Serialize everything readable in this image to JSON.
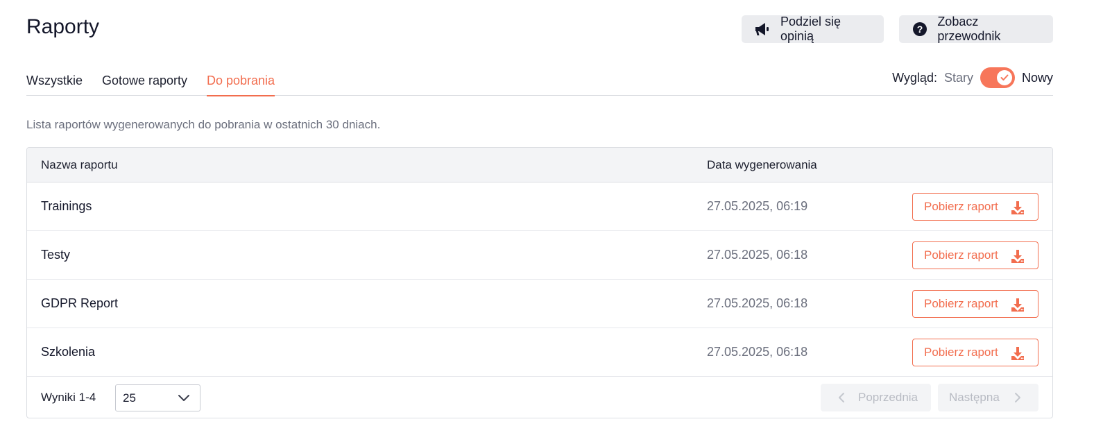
{
  "page": {
    "title": "Raporty"
  },
  "header_actions": {
    "feedback_label": "Podziel się opinią",
    "guide_label": "Zobacz przewodnik"
  },
  "tabs": [
    {
      "label": "Wszystkie",
      "active": false
    },
    {
      "label": "Gotowe raporty",
      "active": false
    },
    {
      "label": "Do pobrania",
      "active": true
    }
  ],
  "view_toggle": {
    "label": "Wygląd:",
    "off_label": "Stary",
    "on_label": "Nowy",
    "enabled": true
  },
  "description": "Lista raportów wygenerowanych do pobrania w ostatnich 30 dniach.",
  "table": {
    "columns": {
      "name": "Nazwa raportu",
      "date": "Data wygenerowania"
    },
    "rows": [
      {
        "name": "Trainings",
        "date": "27.05.2025, 06:19",
        "action": "Pobierz raport"
      },
      {
        "name": "Testy",
        "date": "27.05.2025, 06:18",
        "action": "Pobierz raport"
      },
      {
        "name": "GDPR Report",
        "date": "27.05.2025, 06:18",
        "action": "Pobierz raport"
      },
      {
        "name": "Szkolenia",
        "date": "27.05.2025, 06:18",
        "action": "Pobierz raport"
      }
    ]
  },
  "pagination": {
    "results_label": "Wyniki 1-4",
    "page_size": "25",
    "prev_label": "Poprzednia",
    "next_label": "Następna"
  },
  "colors": {
    "accent": "#f26d4e",
    "toggle_on": "#f7765a",
    "text_primary": "#14172a",
    "text_muted": "#6b6f7d"
  },
  "icons": {
    "feedback": "megaphone-icon",
    "guide": "question-circle-icon",
    "download": "download-icon",
    "select": "chevron-down-icon",
    "prev": "chevron-left-icon",
    "next": "chevron-right-icon"
  }
}
